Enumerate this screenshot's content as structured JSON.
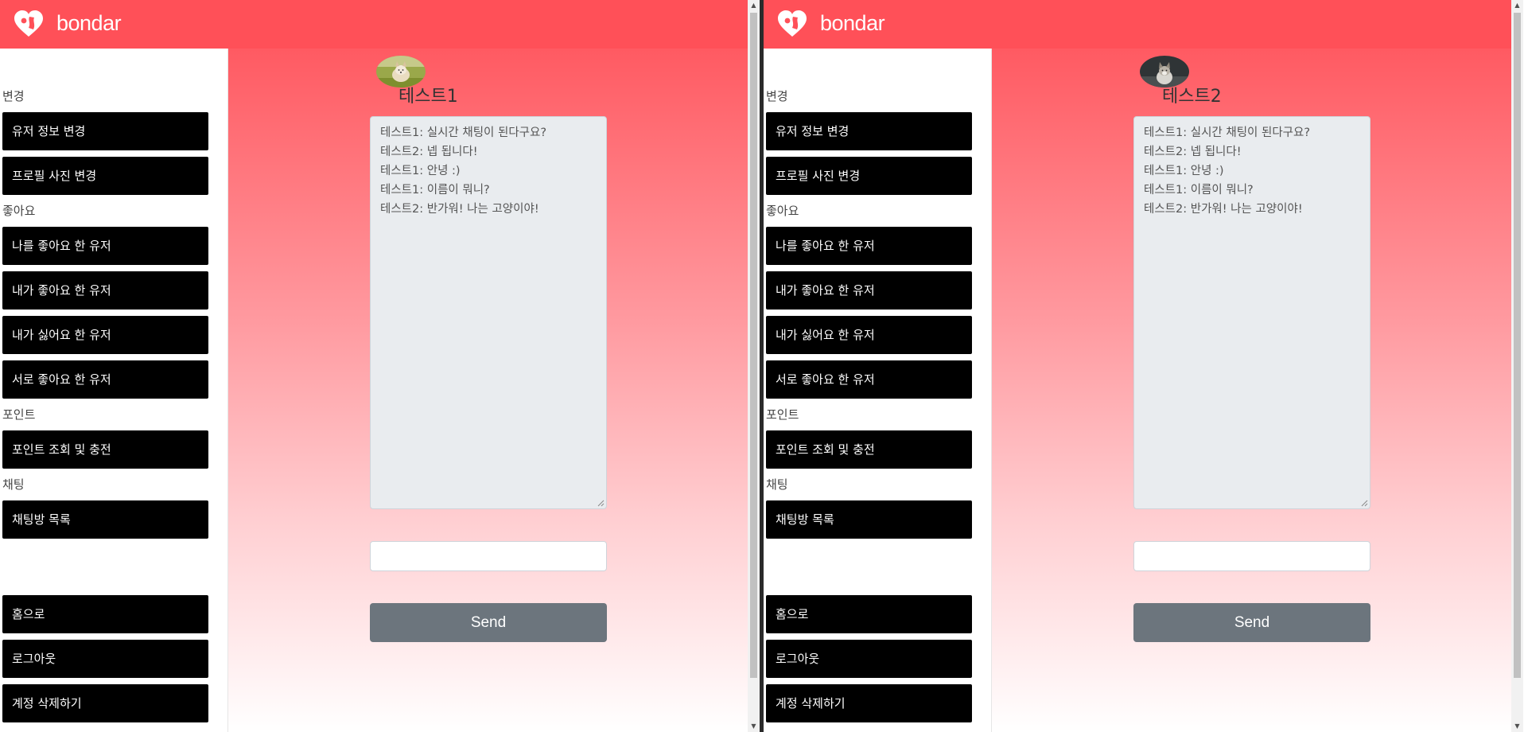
{
  "colors": {
    "navbar": "#ff5058",
    "menu_button": "#000000",
    "send_button": "#6c757d",
    "chat_box": "#e9ecef"
  },
  "brand": {
    "name": "bondar",
    "logo_icon": "heart-logo-icon"
  },
  "sidebar": {
    "sections": {
      "change": "변경",
      "likes": "좋아요",
      "points": "포인트",
      "chat": "채팅"
    },
    "buttons": {
      "user_info": "유저 정보 변경",
      "profile_photo": "프로필 사진 변경",
      "liked_me": "나를 좋아요 한 유저",
      "i_liked": "내가 좋아요 한 유저",
      "i_disliked": "내가 싫어요 한 유저",
      "mutual_like": "서로 좋아요 한 유저",
      "points_charge": "포인트 조회 및 충전",
      "chat_rooms": "채팅방 목록",
      "home": "홈으로",
      "logout": "로그아웃",
      "delete_account": "계정 삭제하기"
    }
  },
  "chat": {
    "messages": [
      "테스트1: 실시간 채팅이 된다구요?",
      "테스트2: 넵 됩니다!",
      "테스트1: 안녕 :)",
      "테스트1: 이름이 뭐니?",
      "테스트2: 반가워! 나는 고양이야!"
    ],
    "input_value": "",
    "send_label": "Send"
  },
  "windows": [
    {
      "partner_name": "테스트1",
      "avatar": "dog-avatar"
    },
    {
      "partner_name": "테스트2",
      "avatar": "cat-avatar"
    }
  ]
}
